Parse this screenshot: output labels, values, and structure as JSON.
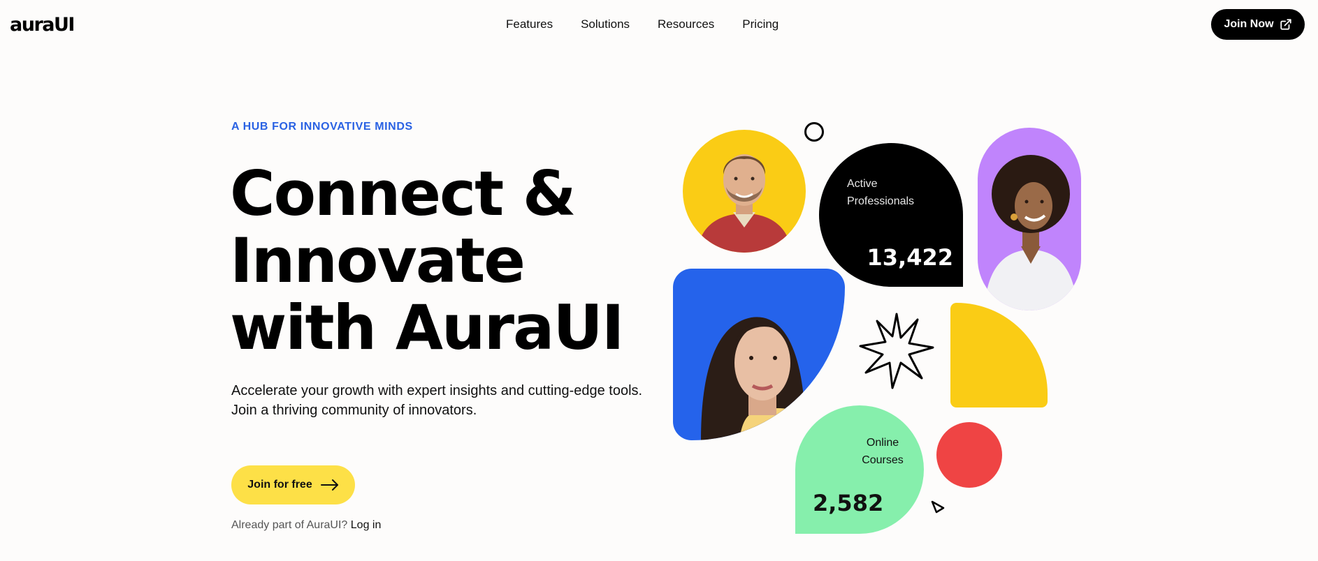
{
  "header": {
    "logo": "auraUI",
    "nav": [
      "Features",
      "Solutions",
      "Resources",
      "Pricing"
    ],
    "join_now": "Join Now",
    "join_icon": "external-link-icon"
  },
  "hero": {
    "eyebrow": "A HUB FOR INNOVATIVE MINDS",
    "headline": [
      "Connect &",
      "Innovate",
      "with AuraUI"
    ],
    "subtext": "Accelerate your growth with expert insights and cutting-edge tools. Join a thriving community of innovators.",
    "cta": "Join for free",
    "cta_icon": "arrow-right-icon",
    "already_text": "Already part of AuraUI?",
    "login_link": "Log in"
  },
  "stats": {
    "professionals_label": "Active Professionals",
    "professionals_value": "13,422",
    "courses_label": "Online Courses",
    "courses_value": "2,582"
  },
  "colors": {
    "accent_blue": "#2563eb",
    "yellow": "#facc15",
    "purple": "#c084fc",
    "green": "#86efac",
    "red": "#ef4444",
    "cta_yellow": "#fde047"
  }
}
